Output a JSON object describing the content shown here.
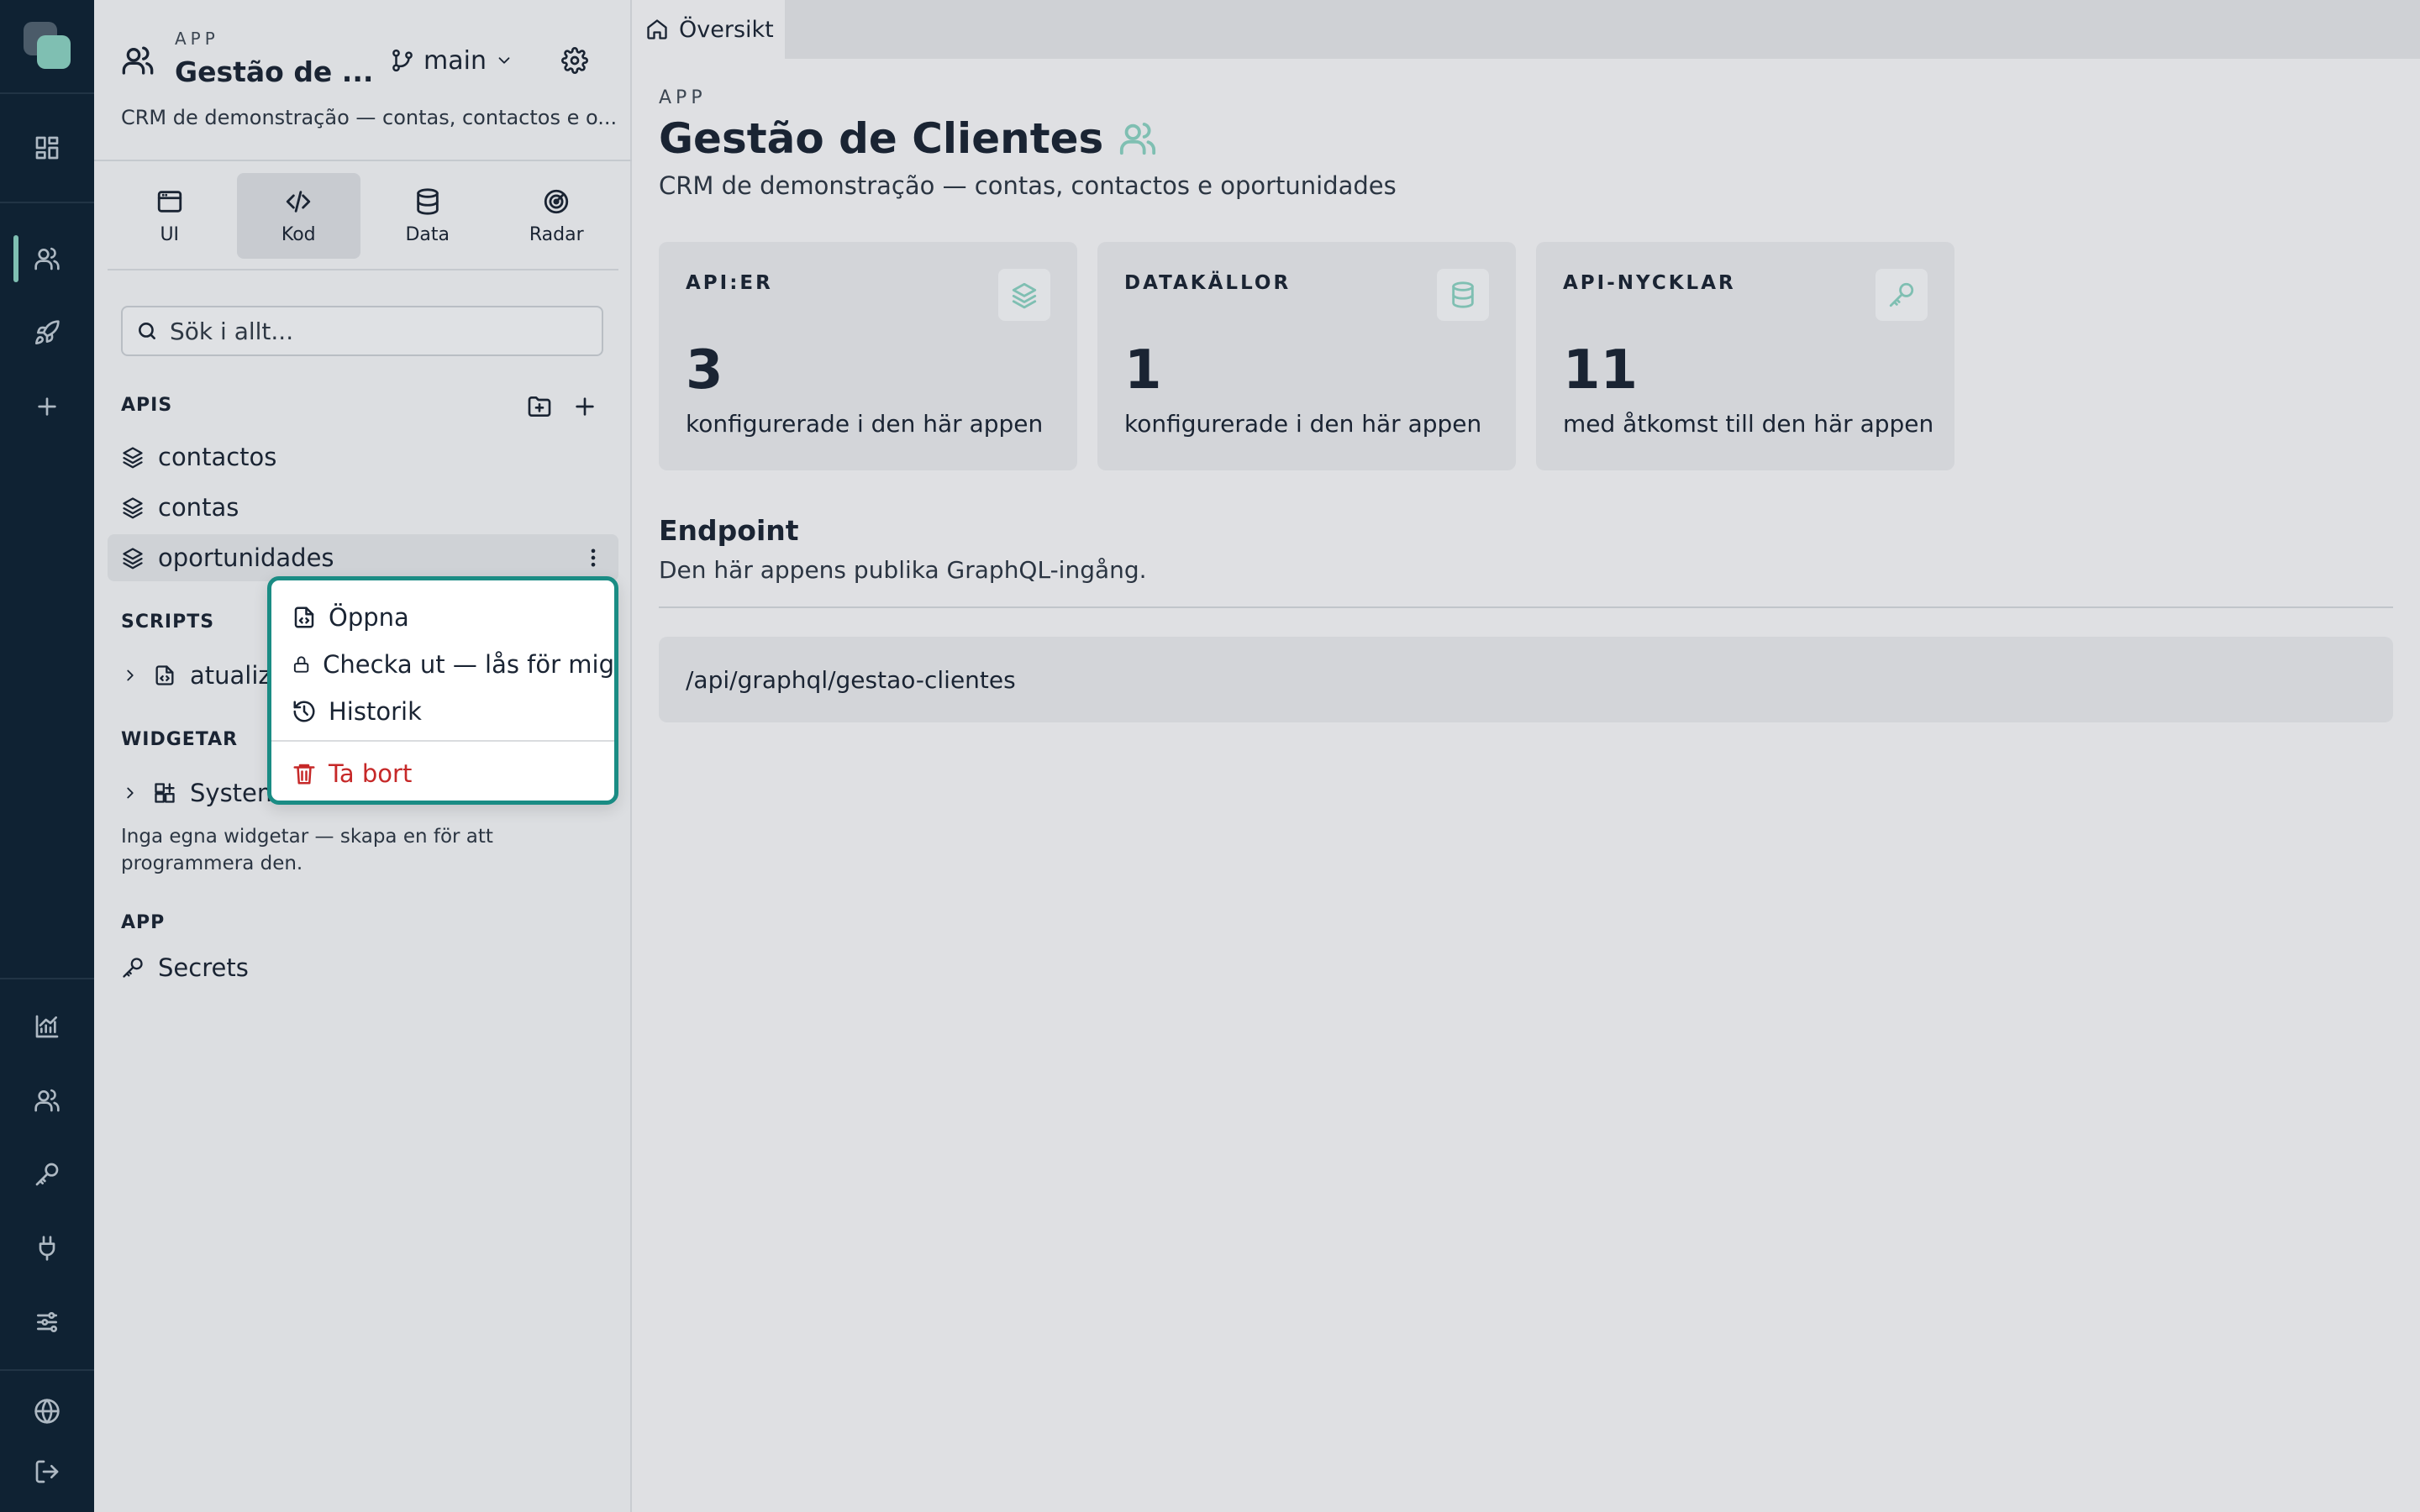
{
  "panel": {
    "eyebrow": "APP",
    "title": "Gestão de ...",
    "branch": "main",
    "description": "CRM de demonstração — contas, contactos e o...",
    "tabs": [
      {
        "label": "UI",
        "icon": "window-icon"
      },
      {
        "label": "Kod",
        "icon": "code-icon"
      },
      {
        "label": "Data",
        "icon": "database-icon"
      },
      {
        "label": "Radar",
        "icon": "radar-icon"
      }
    ],
    "active_tab": "Kod",
    "search_placeholder": "Sök i allt...",
    "sections": {
      "apis": "APIS",
      "scripts": "SCRIPTS",
      "widgets": "WIDGETAR",
      "app": "APP"
    },
    "apis": [
      "contactos",
      "contas",
      "oportunidades"
    ],
    "scripts": [
      "atualiza"
    ],
    "widgets": [
      "System"
    ],
    "widgets_helper": "Inga egna widgetar — skapa en för att programmera den.",
    "app_items": [
      "Secrets"
    ]
  },
  "context_menu": {
    "items": [
      {
        "label": "Öppna",
        "icon": "file-code-icon"
      },
      {
        "label": "Checka ut — lås för mig",
        "icon": "lock-icon"
      },
      {
        "label": "Historik",
        "icon": "history-icon"
      }
    ],
    "danger": {
      "label": "Ta bort",
      "icon": "trash-icon",
      "color": "#c62828"
    }
  },
  "main": {
    "tab": "Översikt",
    "eyebrow": "APP",
    "title": "Gestão de Clientes",
    "description": "CRM de demonstração — contas, contactos e oportunidades",
    "cards": [
      {
        "label": "API:ER",
        "value": "3",
        "sub": "konfigurerade i den här appen",
        "icon": "layers-icon"
      },
      {
        "label": "DATAKÄLLOR",
        "value": "1",
        "sub": "konfigurerade i den här appen",
        "icon": "database-icon"
      },
      {
        "label": "API-NYCKLAR",
        "value": "11",
        "sub": "med åtkomst till den här appen",
        "icon": "key-icon"
      }
    ],
    "endpoint_title": "Endpoint",
    "endpoint_desc": "Den här appens publika GraphQL-ingång.",
    "endpoint_url": "/api/graphql/gestao-clientes"
  },
  "colors": {
    "rail": "#0f2233",
    "accent": "#7fbfb2",
    "focus": "#1a8c84",
    "danger": "#c62828"
  }
}
